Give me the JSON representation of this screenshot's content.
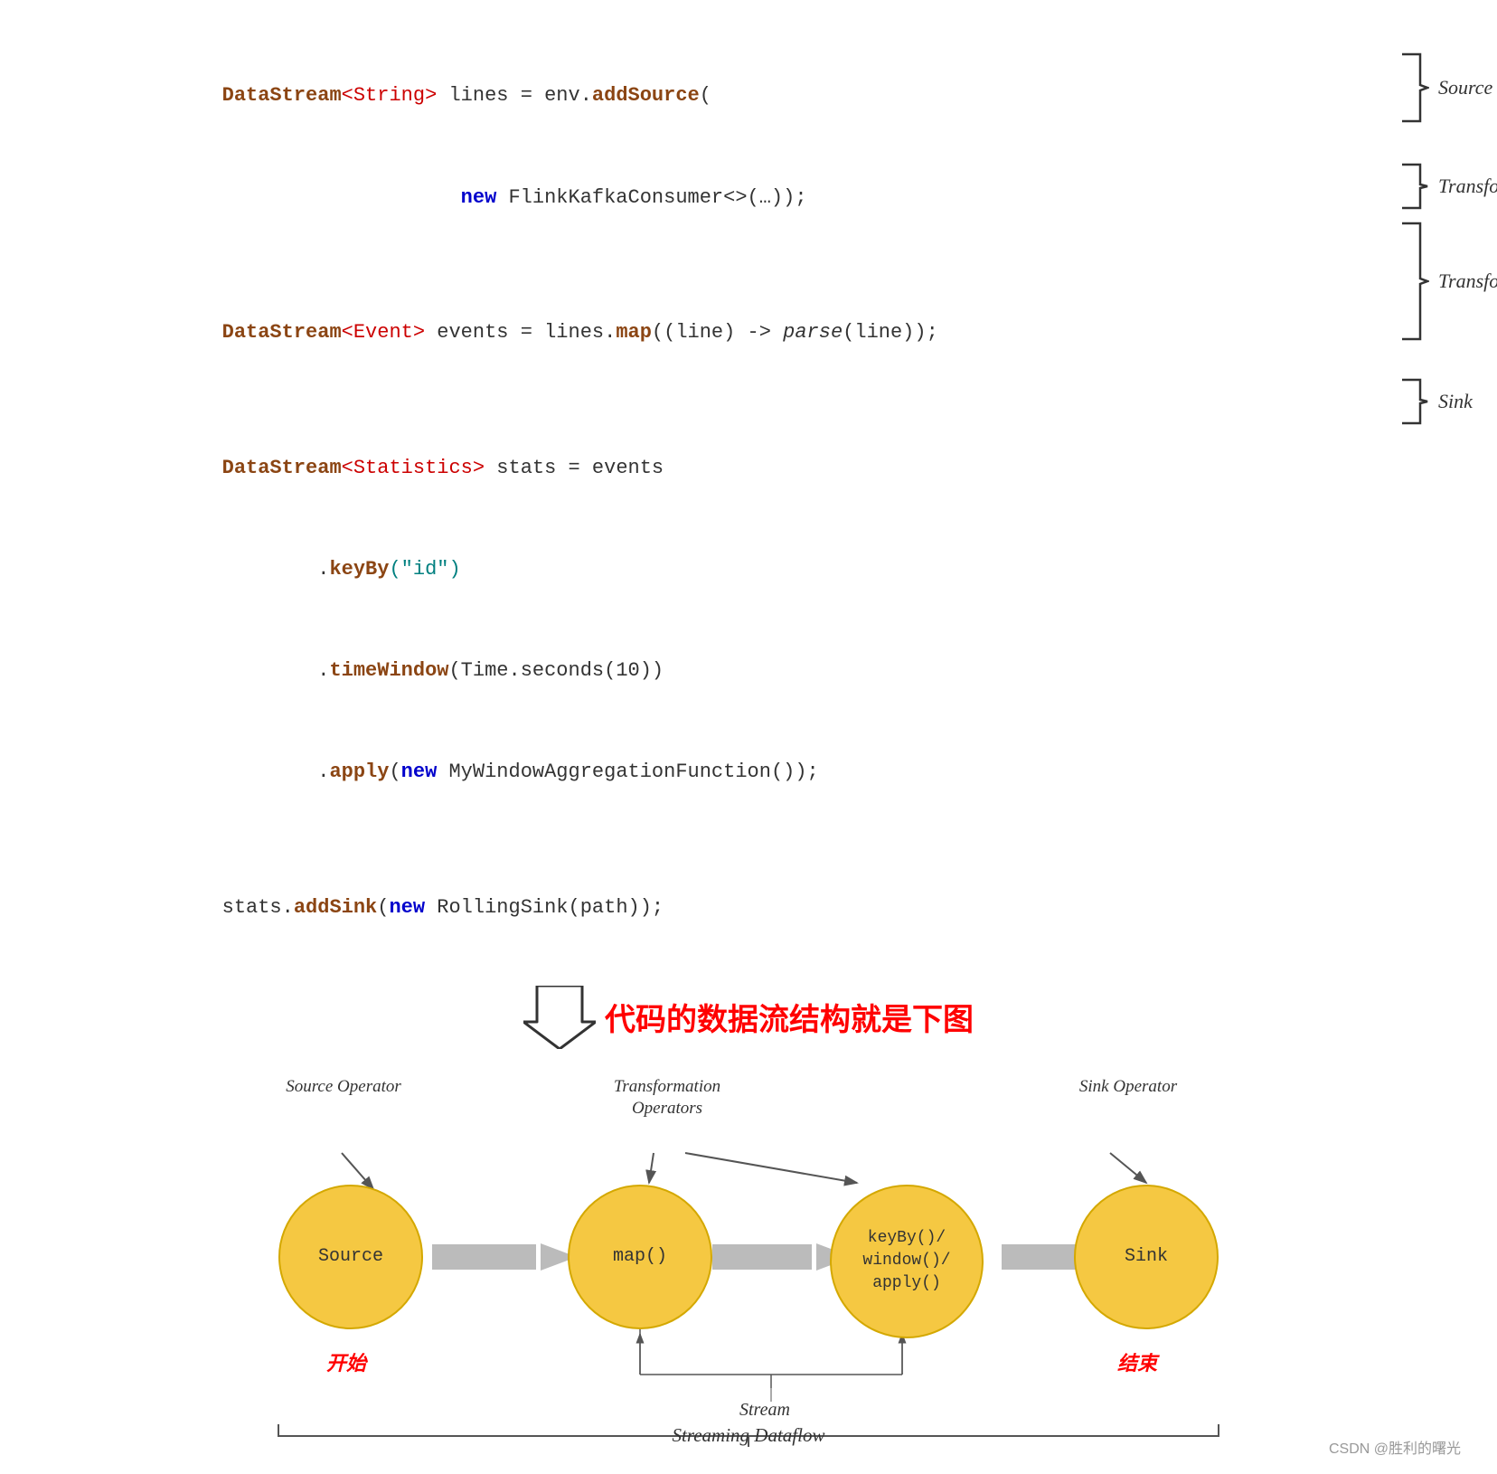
{
  "code": {
    "line1a": "DataStream",
    "line1b": "<String>",
    "line1c": " lines = env.",
    "line1d": "addSource",
    "line1e": "(",
    "line2": "                    new FlinkKafkaConsumer<>(…));",
    "line3a": "DataStream",
    "line3b": "<Event>",
    "line3c": " events = lines.",
    "line3d": "map",
    "line3e": "((line) -> ",
    "line3f": "parse",
    "line3g": "(line));",
    "line4a": "DataStream",
    "line4b": "<Statistics>",
    "line4c": " stats = events",
    "line5a": "        .",
    "line5b": "keyBy",
    "line5c": "(\"id\")",
    "line6a": "        .",
    "line6b": "timeWindow",
    "line6c": "(Time.seconds(10))",
    "line7a": "        .",
    "line7b": "apply",
    "line7c": "(new MyWindowAggregationFunction());",
    "line8a": "stats.",
    "line8b": "addSink",
    "line8c": "(new RollingSink(path));"
  },
  "annotations": {
    "source_label": "Source",
    "transform1_label": "Transformation",
    "transform2_label": "Transformation",
    "sink_label": "Sink"
  },
  "arrow_text": "代码的数据流结构就是下图",
  "diagram": {
    "source_operator": "Source\nOperator",
    "transformation_operators": "Transformation\nOperators",
    "sink_operator": "Sink\nOperator",
    "node_source": "Source",
    "node_map": "map()",
    "node_keyby": "keyBy()/\nwindow()/\napply()",
    "node_sink": "Sink",
    "label_start": "开始",
    "label_end": "结束",
    "stream_label": "Stream",
    "streaming_dataflow": "Streaming Dataflow"
  },
  "footer": "CSDN @胜利的曙光"
}
